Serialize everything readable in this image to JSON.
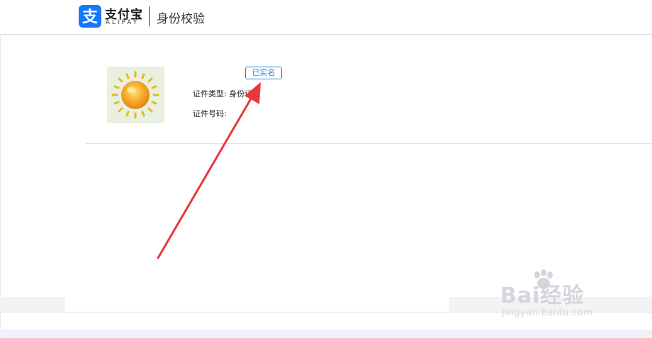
{
  "header": {
    "brand_name": "支付宝",
    "brand_sub": "ALIPAY",
    "page_title": "身份校验",
    "logo_icon": "alipay-logo-icon",
    "brand_color": "#1677ff"
  },
  "profile": {
    "avatar_icon": "sun-avatar-icon",
    "verified_badge": "已实名",
    "id_type_label": "证件类型:",
    "id_type_value": "身份证",
    "id_number_label": "证件号码:",
    "id_number_value": "",
    "accent_color": "#1b8fd8"
  },
  "annotation": {
    "arrow_color": "#e8383d"
  },
  "watermark": {
    "main": "Bai经验",
    "sub": "jingyan.baidu.com"
  }
}
